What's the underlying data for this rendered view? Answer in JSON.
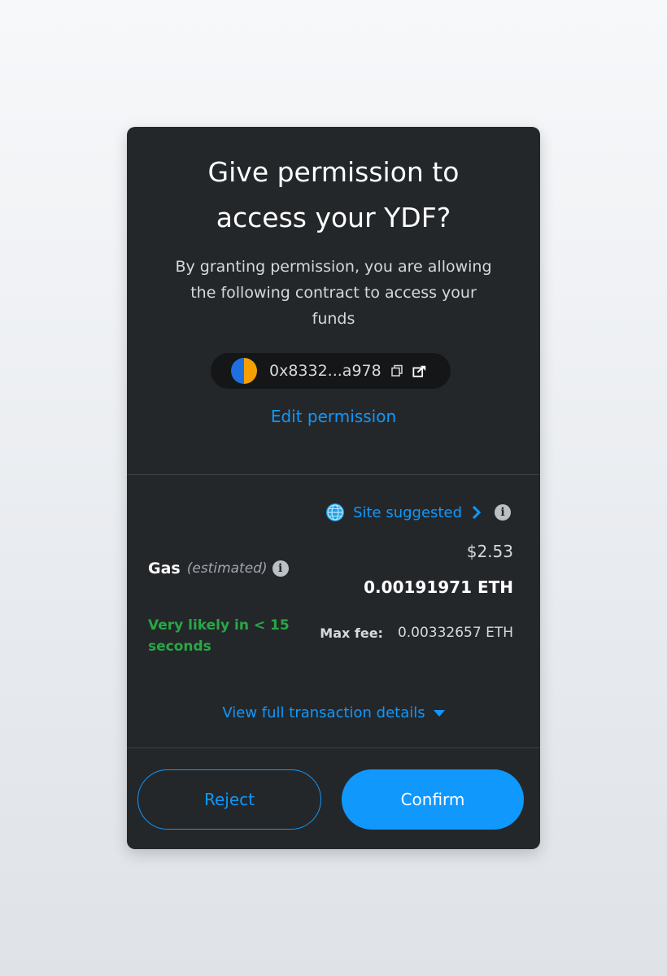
{
  "dialog": {
    "title_line1": "Give permission to",
    "title_line2": "access your YDF?",
    "subtitle_line1": "By granting permission, you are allowing",
    "subtitle_line2": "the following contract to access your",
    "subtitle_line3": "funds",
    "contract_address": "0x8332...a978",
    "edit_permission_label": "Edit permission"
  },
  "gas": {
    "site_suggested_label": "Site suggested",
    "label": "Gas",
    "estimated_label": "(estimated)",
    "usd_value": "$2.53",
    "eth_value": "0.00191971 ETH",
    "likely_line1": "Very likely in < 15",
    "likely_line2": "seconds",
    "max_fee_label": "Max fee:",
    "max_fee_value": "0.00332657 ETH",
    "view_details_label": "View full transaction details"
  },
  "actions": {
    "reject_label": "Reject",
    "confirm_label": "Confirm"
  },
  "colors": {
    "card_background": "#24272a",
    "accent_blue": "#1098fc",
    "success_green": "#28a745"
  },
  "icons": {
    "avatar": "avatar-icon",
    "copy": "copy-icon",
    "external_link": "external-link-icon",
    "globe": "globe-icon",
    "chevron": "chevron-right-icon",
    "info": "info-icon",
    "caret": "caret-down-icon"
  }
}
